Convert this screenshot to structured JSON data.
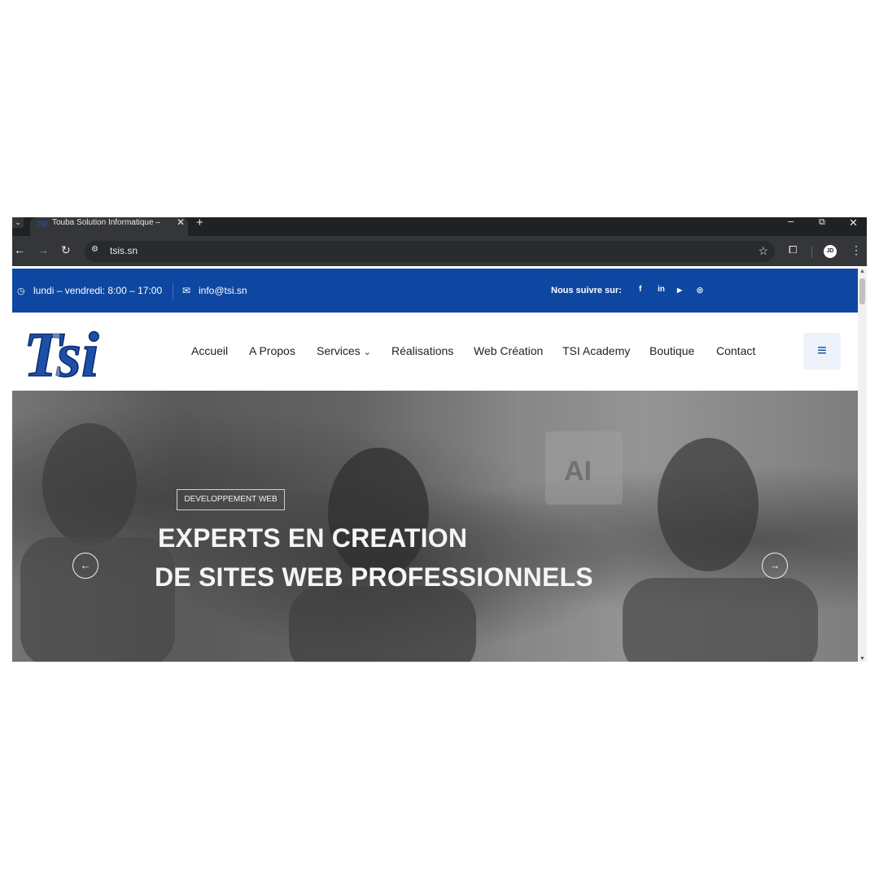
{
  "browser": {
    "tab_title": "Touba Solution Informatique – ",
    "tab_close": "✕",
    "new_tab": "+",
    "url": "tsis.sn",
    "favicon_text": "TSI"
  },
  "topbar": {
    "hours": "lundi – vendredi: 8:00 – 17:00",
    "email": "info@tsi.sn",
    "follow_label": "Nous suivre sur:",
    "social": [
      "f",
      "in",
      "▶",
      "◎"
    ]
  },
  "header": {
    "logo_text": "Tsi",
    "nav": [
      "Accueil",
      "A Propos",
      "Services",
      "Réalisations",
      "Web Création",
      "TSI Academy",
      "Boutique",
      "Contact"
    ]
  },
  "hero": {
    "badge": "DEVELOPPEMENT WEB",
    "headline_1": "EXPERTS EN CREATION",
    "headline_2": "DE SITES WEB PROFESSIONNELS",
    "ai_text": "AI"
  },
  "colors": {
    "brand_blue": "#0d47a1",
    "browser_dark": "#202124",
    "browser_toolbar": "#35363a"
  }
}
